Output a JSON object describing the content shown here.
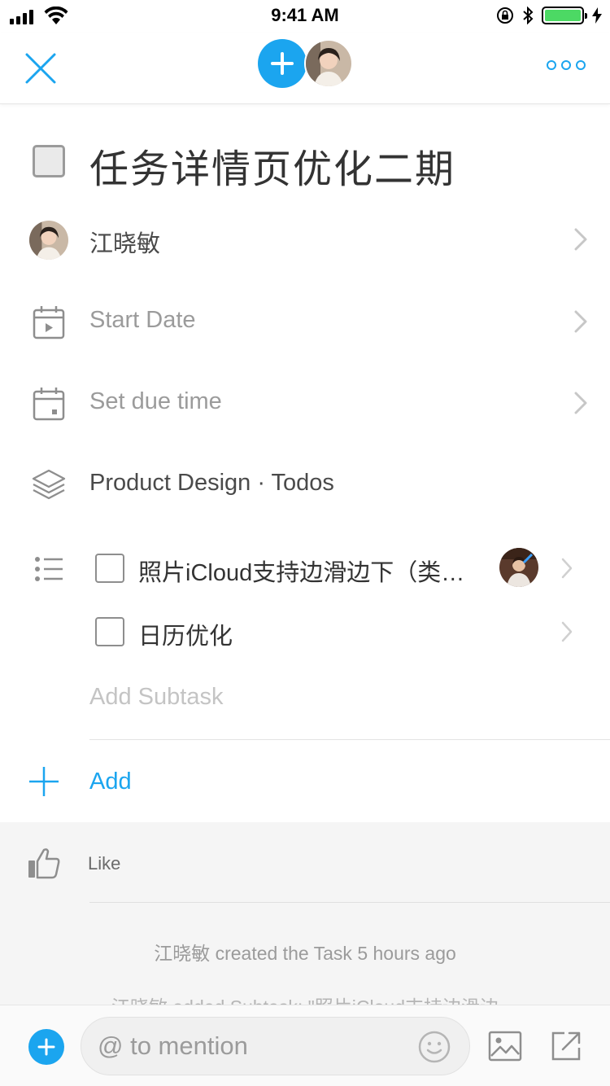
{
  "status_bar": {
    "time": "9:41 AM"
  },
  "header": {
    "close_icon": "close-icon",
    "add_member_icon": "plus-icon",
    "more_icon": "more-icon"
  },
  "task": {
    "title": "任务详情页优化二期"
  },
  "details": {
    "assignee": "江晓敏",
    "start_date": "Start Date",
    "due_time": "Set due time",
    "project": "Product Design · Todos"
  },
  "subtasks": [
    {
      "title": "照片iCloud支持边滑边下（类似微信大图的交互）"
    },
    {
      "title": "日历优化"
    }
  ],
  "add_subtask_placeholder": "Add Subtask",
  "add_label": "Add",
  "activity": {
    "like_label": "Like",
    "entries": [
      "江晓敏 created the Task 5 hours ago",
      "江晓敏 added Subtask: \"照片iCloud支持边滑边"
    ]
  },
  "composer": {
    "placeholder": "@ to mention"
  },
  "colors": {
    "accent": "#1ba5ef",
    "text": "#333333",
    "muted": "#9b9b9b",
    "activity_bg": "#f5f5f5"
  }
}
